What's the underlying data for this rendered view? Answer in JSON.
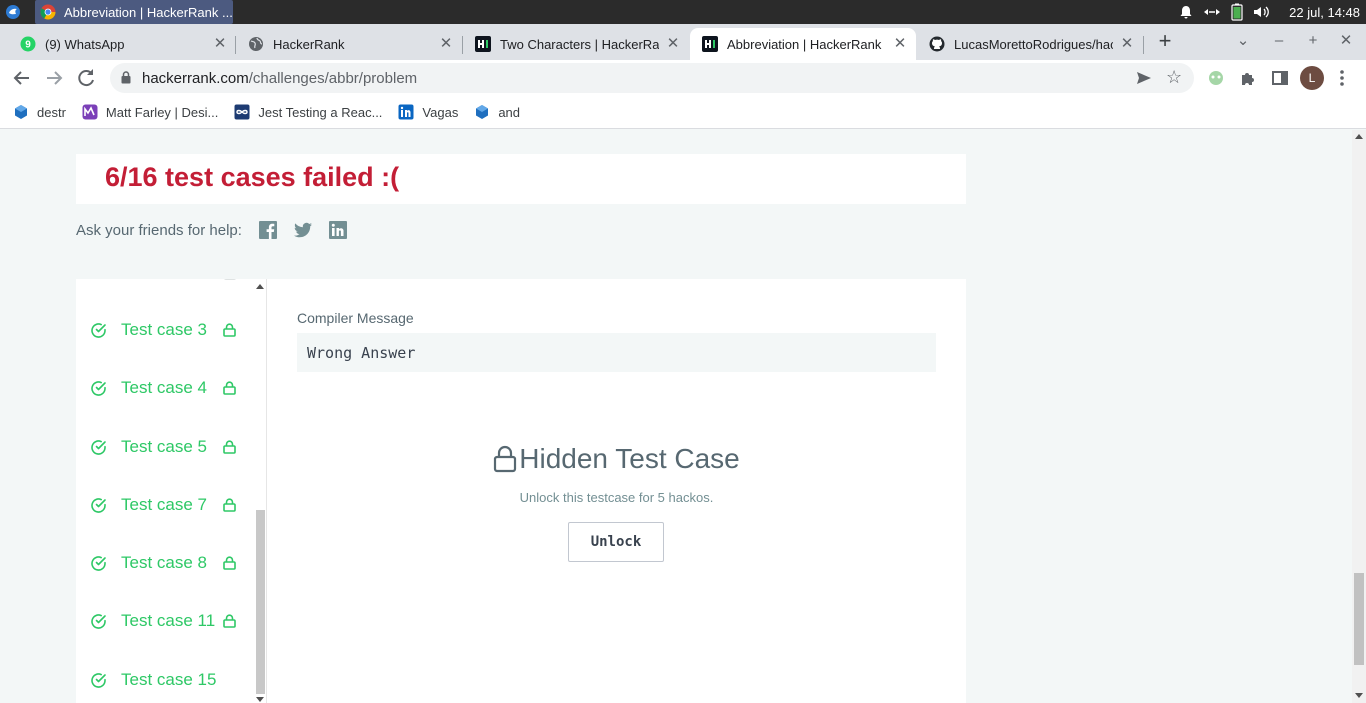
{
  "os": {
    "window_title": "Abbreviation | HackerRank ...",
    "clock": "22 jul, 14:48"
  },
  "tabs": [
    {
      "title": "(9) WhatsApp",
      "icon": "whatsapp-icon"
    },
    {
      "title": "HackerRank",
      "icon": "globe-icon"
    },
    {
      "title": "Two Characters | HackerRank",
      "icon": "hackerrank-icon"
    },
    {
      "title": "Abbreviation | HackerRank",
      "icon": "hackerrank-icon",
      "active": true
    },
    {
      "title": "LucasMorettoRodrigues/hackerrank",
      "icon": "github-icon"
    }
  ],
  "toolbar": {
    "url_host": "hackerrank.com",
    "url_path": "/challenges/abbr/problem",
    "profile_initial": "L"
  },
  "bookmarks": [
    {
      "label": "destr",
      "icon": "cube-icon"
    },
    {
      "label": "Matt Farley | Desi...",
      "icon": "chart-icon"
    },
    {
      "label": "Jest Testing a Reac...",
      "icon": "infinity-icon"
    },
    {
      "label": "Vagas",
      "icon": "linkedin-icon"
    },
    {
      "label": "and",
      "icon": "cube-icon"
    }
  ],
  "result": {
    "title": "6/16 test cases failed :("
  },
  "share": {
    "label": "Ask your friends for help:",
    "networks": [
      "facebook-icon",
      "twitter-icon",
      "linkedin-icon"
    ]
  },
  "test_cases": [
    {
      "name": "Test case 3",
      "locked": true
    },
    {
      "name": "Test case 4",
      "locked": true
    },
    {
      "name": "Test case 5",
      "locked": true
    },
    {
      "name": "Test case 7",
      "locked": true
    },
    {
      "name": "Test case 8",
      "locked": true
    },
    {
      "name": "Test case 11",
      "locked": true
    },
    {
      "name": "Test case 15",
      "locked": false
    }
  ],
  "detail": {
    "compiler_label": "Compiler Message",
    "compiler_message": "Wrong Answer",
    "hidden_title": "Hidden Test Case",
    "unlock_note": "Unlock this testcase for 5 hackos.",
    "unlock_button": "Unlock"
  },
  "colors": {
    "failed": "#c31e36",
    "passed": "#2ec866",
    "text": "#576871"
  }
}
